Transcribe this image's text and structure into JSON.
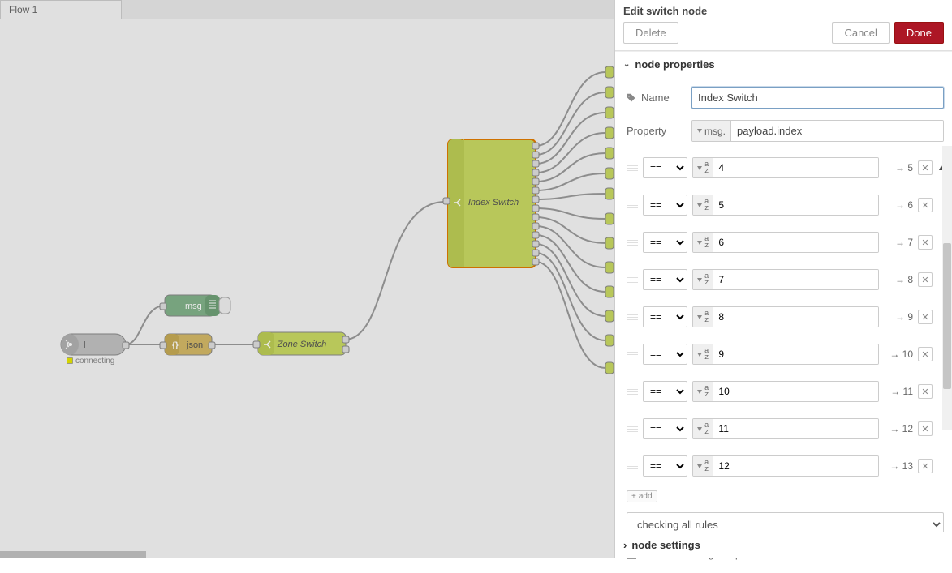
{
  "tabs": {
    "flow_label": "Flow 1"
  },
  "canvas": {
    "websocket": {
      "label": "l",
      "status": "connecting"
    },
    "debug_node": "msg",
    "json_node": "json",
    "zone_switch": "Zone Switch",
    "index_switch": "Index Switch"
  },
  "panel": {
    "title": "Edit switch node",
    "buttons": {
      "delete": "Delete",
      "cancel": "Cancel",
      "done": "Done"
    },
    "section_props_title": "node properties",
    "name_label": "Name",
    "name_value": "Index Switch",
    "property_label": "Property",
    "property_type": "msg.",
    "property_value": "payload.index",
    "op_eq": "==",
    "rules": [
      {
        "value": "4",
        "output": "5",
        "sort": "up"
      },
      {
        "value": "5",
        "output": "6",
        "sort": ""
      },
      {
        "value": "6",
        "output": "7",
        "sort": ""
      },
      {
        "value": "7",
        "output": "8",
        "sort": ""
      },
      {
        "value": "8",
        "output": "9",
        "sort": ""
      },
      {
        "value": "9",
        "output": "10",
        "sort": ""
      },
      {
        "value": "10",
        "output": "11",
        "sort": ""
      },
      {
        "value": "11",
        "output": "12",
        "sort": ""
      },
      {
        "value": "12",
        "output": "13",
        "sort": ""
      }
    ],
    "add_label": "add",
    "mode_select": "checking all rules",
    "recreate_label": "recreate message sequences",
    "section_settings_title": "node settings"
  }
}
